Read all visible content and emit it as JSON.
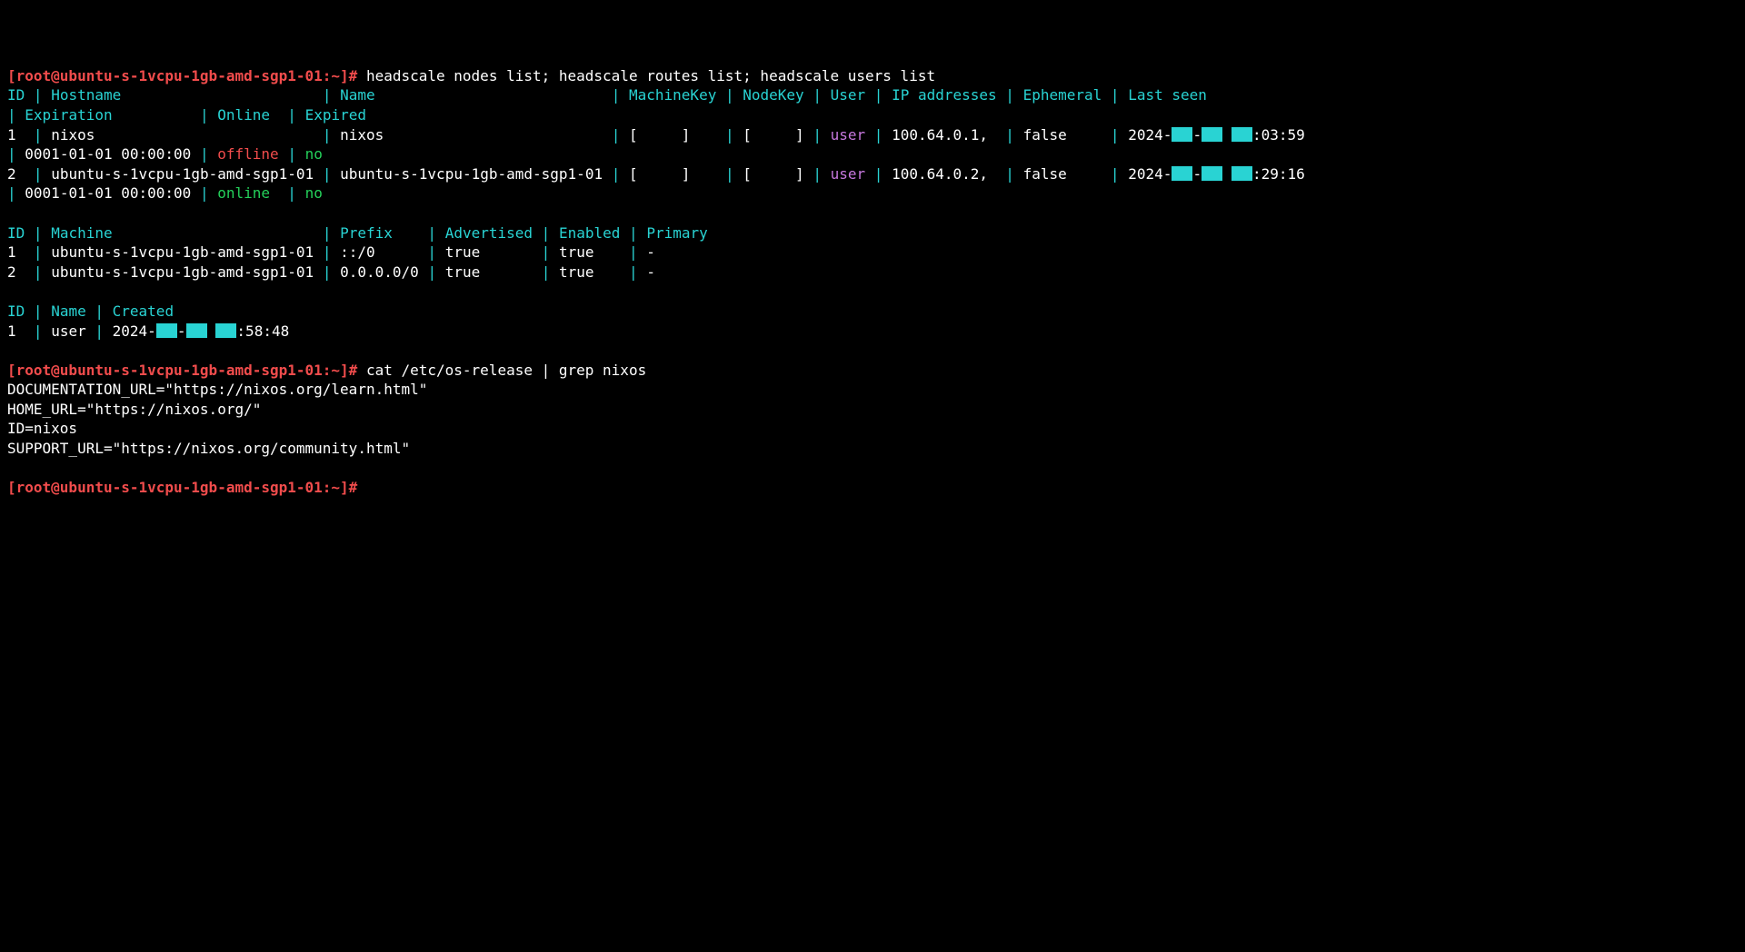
{
  "prompt": "[root@ubuntu-s-1vcpu-1gb-amd-sgp1-01:~]#",
  "commands": {
    "c1": "headscale nodes list; headscale routes list; headscale users list",
    "c2": "cat /etc/os-release | grep nixos"
  },
  "nodes_header": {
    "id": "ID",
    "hostname": "Hostname",
    "name": "Name",
    "machinekey": "MachineKey",
    "nodekey": "NodeKey",
    "user": "User",
    "ip": "IP addresses",
    "ephemeral": "Ephemeral",
    "lastseen": "Last seen",
    "expiration": "Expiration",
    "online": "Online",
    "expired": "Expired"
  },
  "nodes": [
    {
      "id": "1",
      "hostname": "nixos",
      "name": "nixos",
      "machinekey": "[     ]",
      "nodekey": "[     ]",
      "user": "user",
      "ip": "100.64.0.1,",
      "ephemeral": "false",
      "lastseen_prefix": "2024-",
      "lastseen_suffix": ":03:59",
      "expiration": "0001-01-01 00:00:00",
      "online": "offline",
      "expired": "no"
    },
    {
      "id": "2",
      "hostname": "ubuntu-s-1vcpu-1gb-amd-sgp1-01",
      "name": "ubuntu-s-1vcpu-1gb-amd-sgp1-01",
      "machinekey": "[     ]",
      "nodekey": "[     ]",
      "user": "user",
      "ip": "100.64.0.2,",
      "ephemeral": "false",
      "lastseen_prefix": "2024-",
      "lastseen_suffix": ":29:16",
      "expiration": "0001-01-01 00:00:00",
      "online": "online",
      "expired": "no"
    }
  ],
  "routes_header": {
    "id": "ID",
    "machine": "Machine",
    "prefix": "Prefix",
    "advertised": "Advertised",
    "enabled": "Enabled",
    "primary": "Primary"
  },
  "routes": [
    {
      "id": "1",
      "machine": "ubuntu-s-1vcpu-1gb-amd-sgp1-01",
      "prefix": "::/0",
      "advertised": "true",
      "enabled": "true",
      "primary": "-"
    },
    {
      "id": "2",
      "machine": "ubuntu-s-1vcpu-1gb-amd-sgp1-01",
      "prefix": "0.0.0.0/0",
      "advertised": "true",
      "enabled": "true",
      "primary": "-"
    }
  ],
  "users_header": {
    "id": "ID",
    "name": "Name",
    "created": "Created"
  },
  "users": [
    {
      "id": "1",
      "name": "user",
      "created_prefix": "2024-",
      "created_suffix": ":58:48"
    }
  ],
  "os_release": [
    "DOCUMENTATION_URL=\"https://nixos.org/learn.html\"",
    "HOME_URL=\"https://nixos.org/\"",
    "ID=nixos",
    "SUPPORT_URL=\"https://nixos.org/community.html\""
  ]
}
